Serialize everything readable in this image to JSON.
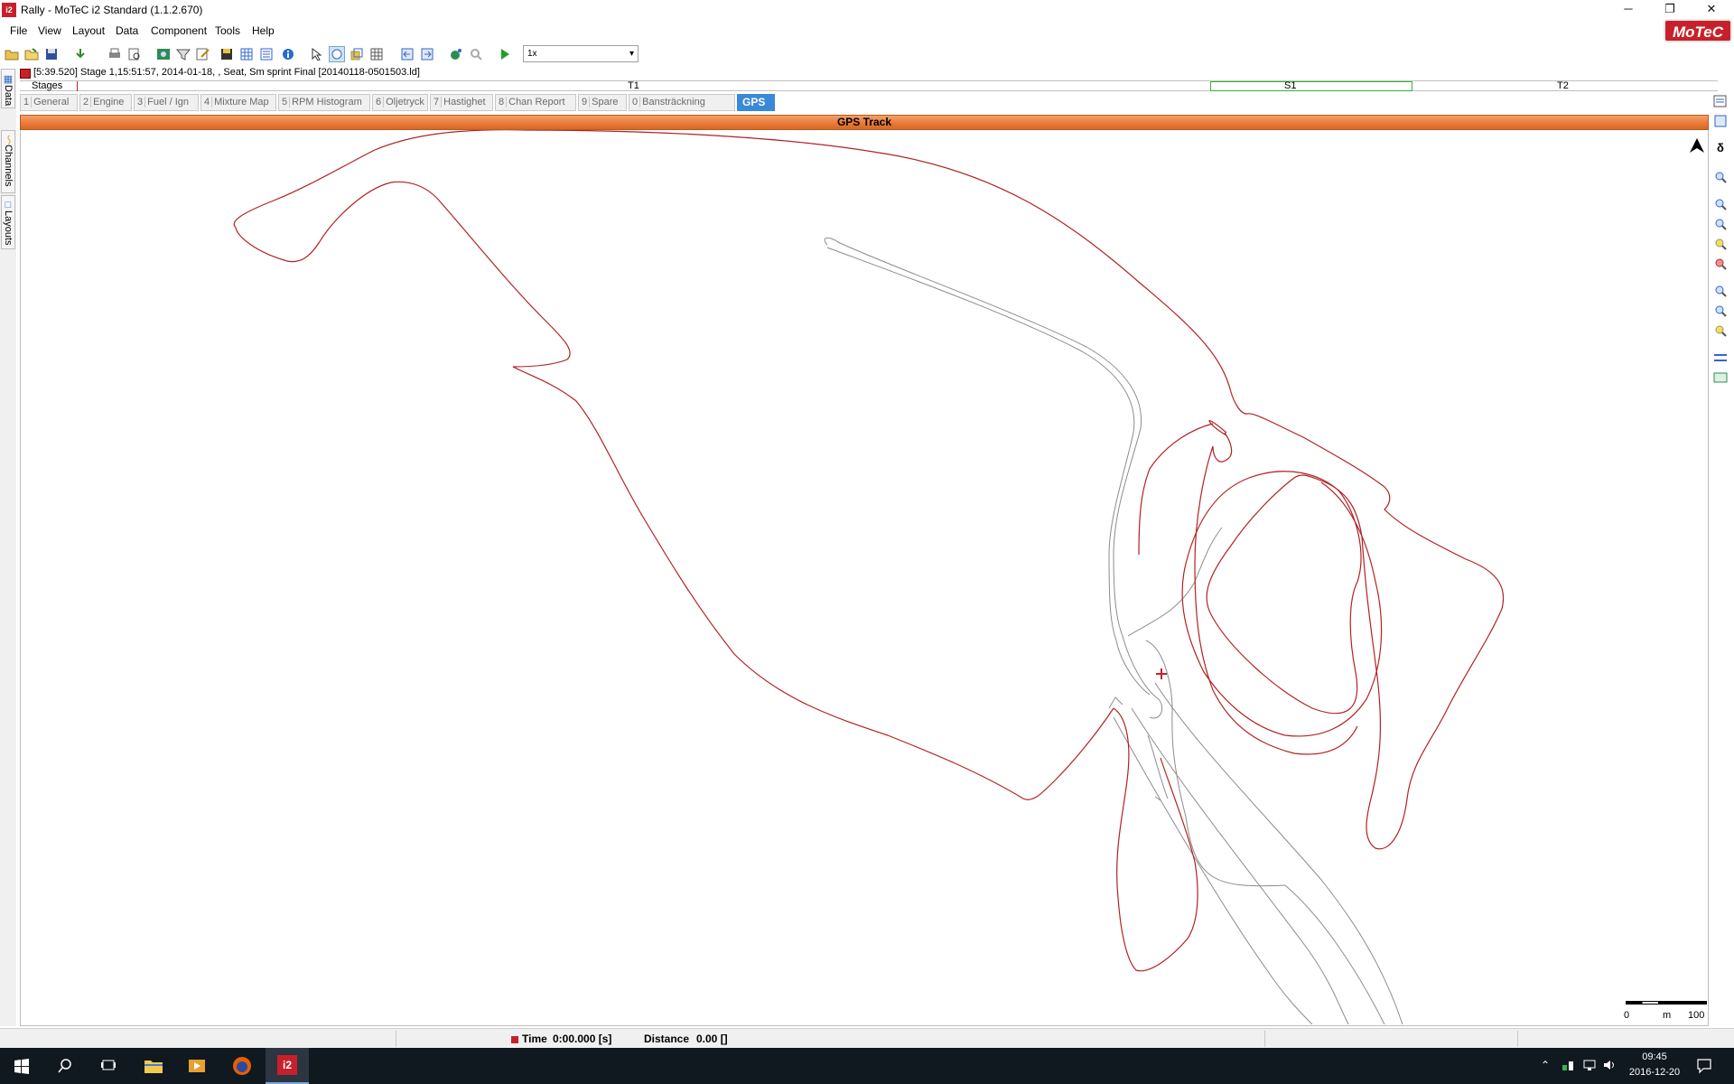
{
  "window": {
    "title": "Rally - MoTeC i2 Standard (1.1.2.670)",
    "app_icon_text": "i2",
    "minimize": "─",
    "restore": "❐",
    "close": "✕"
  },
  "menu": [
    "File",
    "View",
    "Layout",
    "Data",
    "Component",
    "Tools",
    "Help"
  ],
  "brand": {
    "logo_text": "MoTeC",
    "color": "#c8202a"
  },
  "toolbar": {
    "playback_speed": "1x"
  },
  "left_tabs": [
    "Data",
    "Channels",
    "Layouts"
  ],
  "info_line": "[5:39.520] Stage 1,15:51:57, 2014-01-18,  , Seat, Sm sprint Final [20140118-0501503.ld]",
  "stages": {
    "label": "Stages",
    "marks": [
      "T1",
      "S1",
      "T2"
    ]
  },
  "worksheets": [
    {
      "num": "1",
      "label": "General"
    },
    {
      "num": "2",
      "label": "Engine"
    },
    {
      "num": "3",
      "label": "Fuel / Ign"
    },
    {
      "num": "4",
      "label": "Mixture Map"
    },
    {
      "num": "5",
      "label": "RPM Histogram"
    },
    {
      "num": "6",
      "label": "Oljetryck"
    },
    {
      "num": "7",
      "label": "Hastighet"
    },
    {
      "num": "8",
      "label": "Chan Report"
    },
    {
      "num": "9",
      "label": "Spare"
    },
    {
      "num": "0",
      "label": "Bansträckning"
    },
    {
      "num": "",
      "label": "GPS"
    }
  ],
  "active_worksheet": "GPS",
  "gps_panel": {
    "title": "GPS Track",
    "track_color": "#b22222",
    "ghost_color": "#8c8c8c",
    "header_color": "#e87b3a",
    "scale": {
      "start": "0",
      "unit": "m",
      "end": "100"
    }
  },
  "status": {
    "time_label": "Time",
    "time_value": "0:00.000 [s]",
    "distance_label": "Distance",
    "distance_value": "0.00 []"
  },
  "taskbar": {
    "time": "09:45",
    "date": "2016-12-20",
    "active_app": "i2"
  }
}
